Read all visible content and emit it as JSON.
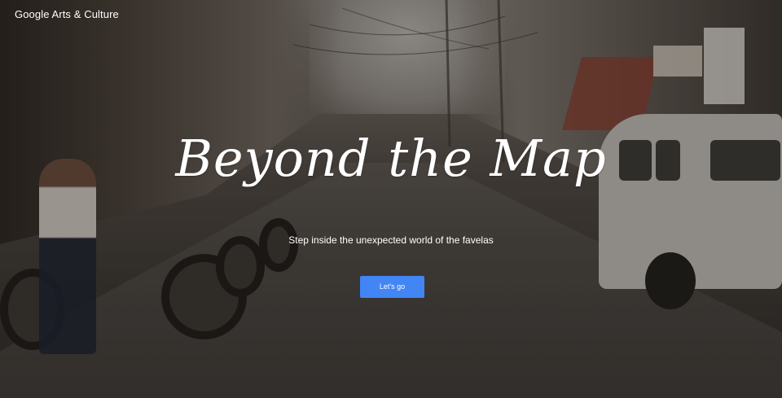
{
  "header": {
    "brand": "Google Arts & Culture"
  },
  "hero": {
    "title": "Beyond the Map",
    "subtitle": "Step inside the unexpected world of the favelas",
    "cta_label": "Let's go"
  },
  "colors": {
    "cta_background": "#4285f4",
    "text": "#ffffff"
  }
}
